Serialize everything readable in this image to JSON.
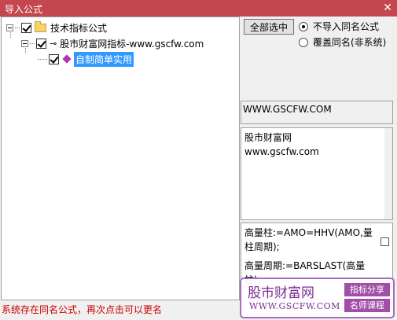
{
  "window": {
    "title": "导入公式",
    "close_glyph": "✕"
  },
  "tree": {
    "root": {
      "label": "技术指标公式",
      "checked": true,
      "icon": "folder-icon"
    },
    "child": {
      "label": "股市财富网指标-www.gscfw.com",
      "checked": true,
      "icon": "key-icon",
      "icon_glyph": "⊸"
    },
    "leaf": {
      "label": "自制简单实用",
      "checked": true,
      "selected": true,
      "icon": "gem-icon"
    }
  },
  "options": {
    "select_all_label": "全部选中",
    "radio_skip_label": "不导入同名公式",
    "radio_overwrite_label": "覆盖同名(非系统)",
    "selected_radio": "skip"
  },
  "formula_info": {
    "url": "WWW.GSCFW.COM",
    "description_line1": "股市财富网",
    "description_line2": "www.gscfw.com"
  },
  "code": {
    "line1": "高量柱:=AMO=HHV(AMO,量柱周期);",
    "line2": "高量周期:=BARSLAST(高量柱);"
  },
  "status_message": "系统存在同名公式，再次点击可以更名",
  "watermark": {
    "site_name": "股市财富网",
    "site_url": "WWW.GSCFW.COM",
    "tag1": "指标分享",
    "tag2": "名师课程"
  },
  "colors": {
    "titlebar": "#c4464e",
    "selection": "#3399ff",
    "status_text": "#cc0000",
    "watermark_accent": "#7b2f96"
  }
}
